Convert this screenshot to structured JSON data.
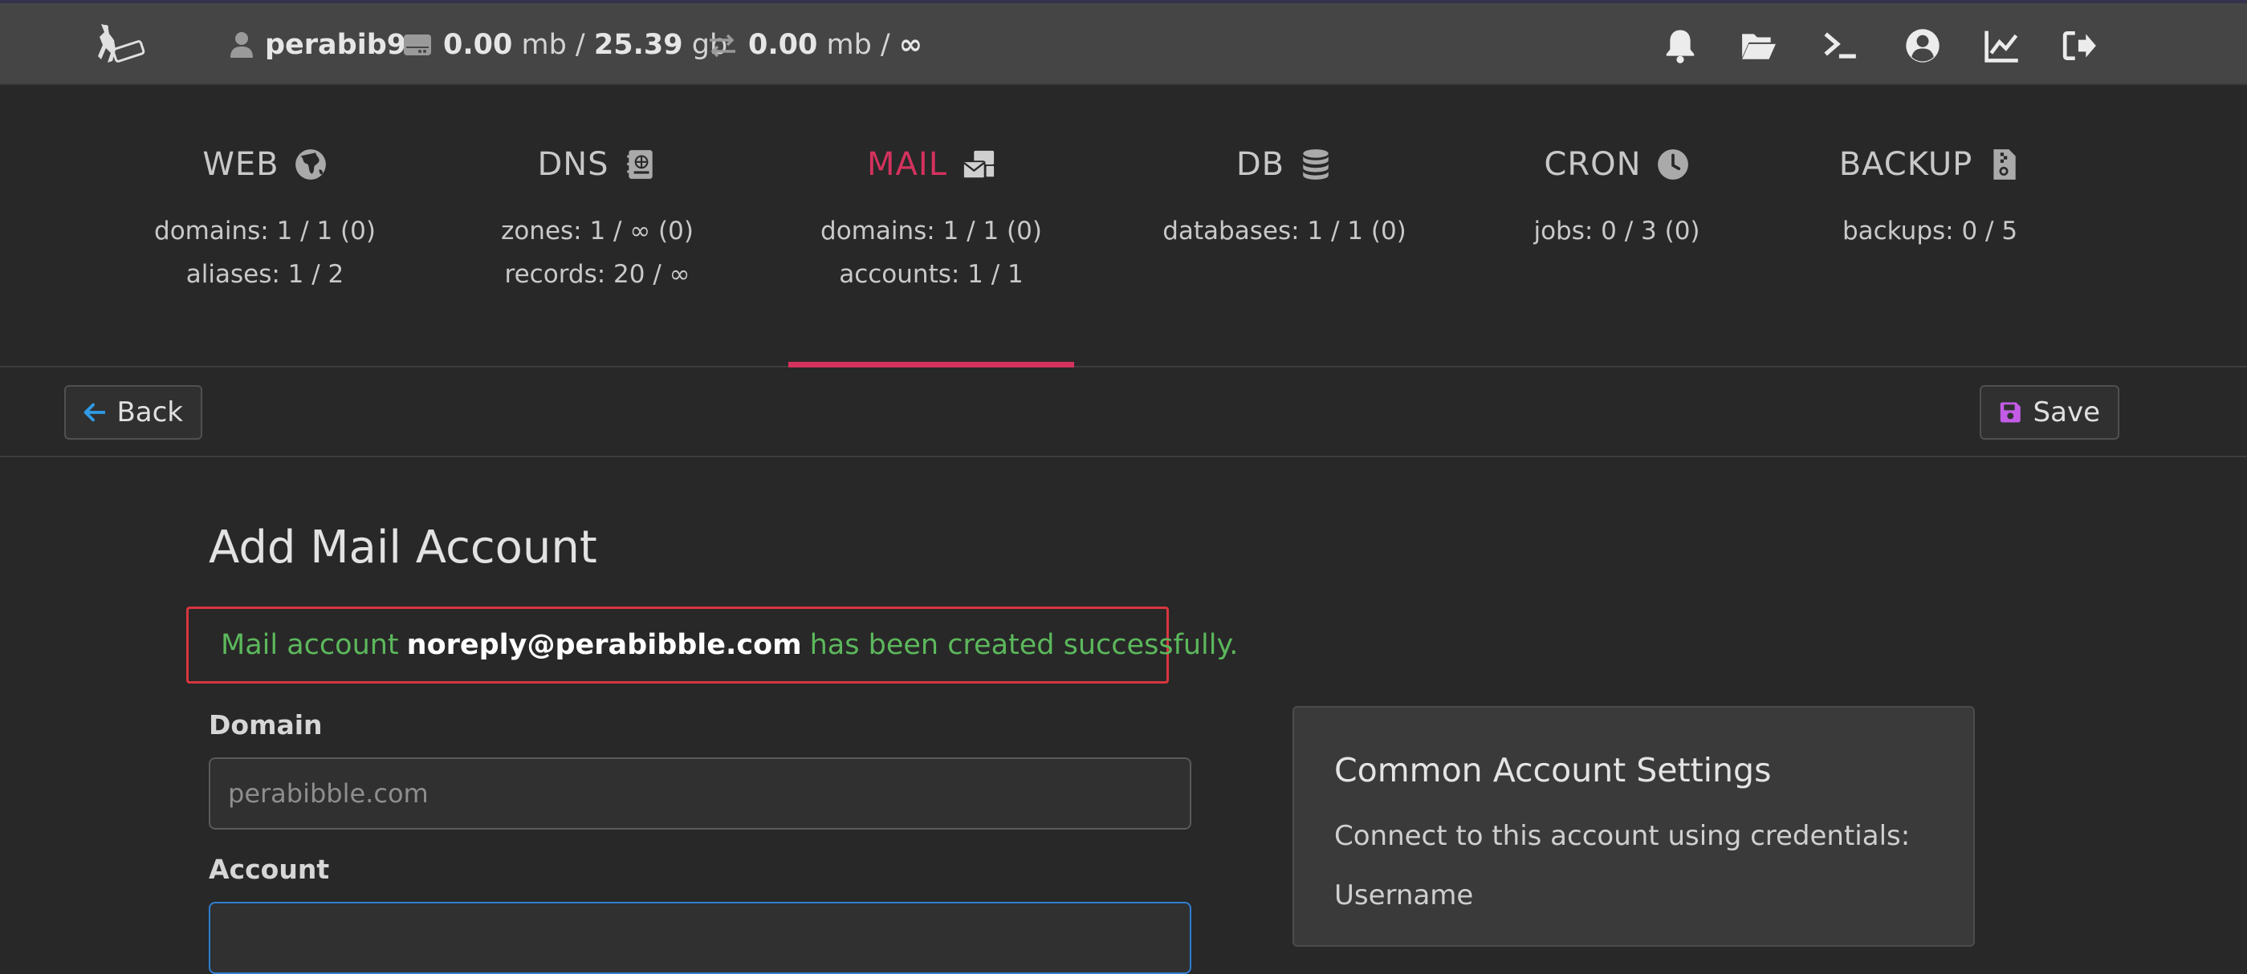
{
  "topbar": {
    "username": "perabib9",
    "disk_used": "0.00",
    "disk_used_unit": "mb /",
    "disk_total": "25.39",
    "disk_total_unit": "gb",
    "bw_used": "0.00",
    "bw_used_unit": "mb /",
    "bw_total": "∞",
    "icons": [
      "bell-icon",
      "folder-open-icon",
      "terminal-icon",
      "user-circle-icon",
      "chart-line-icon",
      "logout-icon"
    ]
  },
  "menu": {
    "items": [
      {
        "title": "WEB",
        "icon": "globe-icon",
        "line1": "domains: 1 / 1 (0)",
        "line2": "aliases: 1 / 2"
      },
      {
        "title": "DNS",
        "icon": "address-book-icon",
        "line1": "zones: 1 / ∞ (0)",
        "line2": "records: 20 / ∞"
      },
      {
        "title": "MAIL",
        "icon": "mail-bulk-icon",
        "line1": "domains: 1 / 1 (0)",
        "line2": "accounts: 1 / 1"
      },
      {
        "title": "DB",
        "icon": "database-icon",
        "line1": "databases: 1 / 1 (0)",
        "line2": ""
      },
      {
        "title": "CRON",
        "icon": "clock-icon",
        "line1": "jobs: 0 / 3 (0)",
        "line2": ""
      },
      {
        "title": "BACKUP",
        "icon": "file-archive-icon",
        "line1": "backups: 0 / 5",
        "line2": ""
      }
    ],
    "active": "MAIL",
    "active_color": "#d4325e"
  },
  "toolbar": {
    "back_label": "Back",
    "save_label": "Save"
  },
  "form": {
    "title": "Add Mail Account",
    "alert_prefix": "Mail account",
    "alert_email": "noreply@perabibble.com",
    "alert_suffix": "has been created successfully.",
    "domain_label": "Domain",
    "domain_value": "perabibble.com",
    "account_label": "Account"
  },
  "card": {
    "title": "Common Account Settings",
    "text": "Connect to this account using credentials:",
    "username_label": "Username"
  },
  "colors": {
    "accent": "#d4325e",
    "success": "#5cb85c",
    "alert_border": "#d9363e",
    "back_icon": "#2f9be6",
    "save_icon": "#c25ce6"
  }
}
